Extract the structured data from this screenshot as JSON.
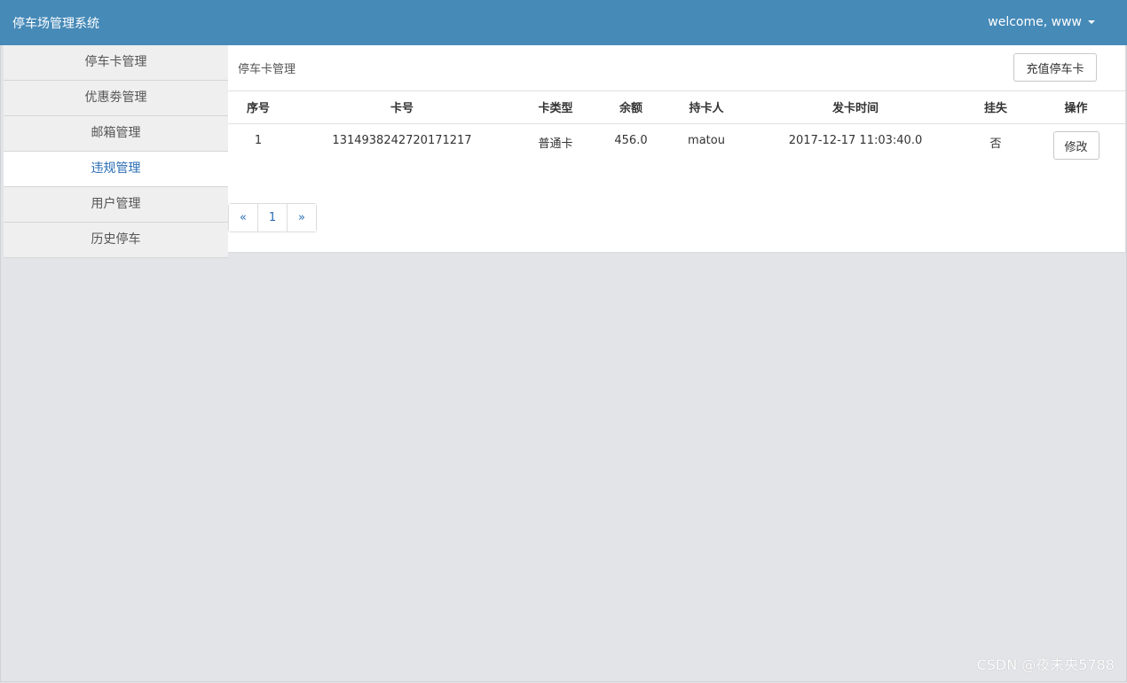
{
  "header": {
    "brand": "停车场管理系统",
    "user_label": "welcome, www"
  },
  "sidebar": {
    "items": [
      {
        "label": "停车卡管理"
      },
      {
        "label": "优惠劵管理"
      },
      {
        "label": "邮箱管理"
      },
      {
        "label": "违规管理",
        "active": true
      },
      {
        "label": "用户管理"
      },
      {
        "label": "历史停车"
      }
    ]
  },
  "main": {
    "title": "停车卡管理",
    "recharge_button": "充值停车卡",
    "table": {
      "headers": [
        "序号",
        "卡号",
        "卡类型",
        "余额",
        "持卡人",
        "发卡时间",
        "挂失",
        "操作"
      ],
      "rows": [
        {
          "index": "1",
          "card_no": "1314938242720171217",
          "card_type": "普通卡",
          "balance": "456.0",
          "holder": "matou",
          "issue_time": "2017-12-17 11:03:40.0",
          "lost": "否",
          "action": "修改"
        }
      ]
    },
    "pagination": {
      "prev": "«",
      "page": "1",
      "next": "»"
    }
  },
  "watermark": "CSDN @夜未央5788",
  "colors": {
    "header_bg": "#468ab8",
    "active_link": "#2a6db5",
    "page_bg": "#e3e4e8"
  }
}
